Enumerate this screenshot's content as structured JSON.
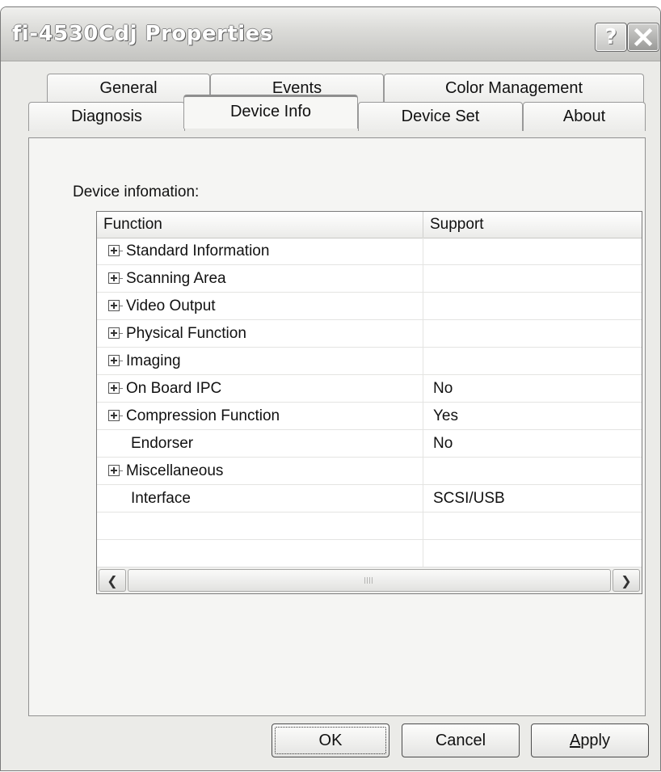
{
  "window": {
    "title": "fi-4530Cdj Properties",
    "help_glyph": "?",
    "close_icon": "close-icon"
  },
  "tabs": {
    "row_top": [
      {
        "label": "General"
      },
      {
        "label": "Events"
      },
      {
        "label": "Color Management"
      }
    ],
    "row_bottom": [
      {
        "label": "Diagnosis"
      },
      {
        "label": "Device Info",
        "selected": true
      },
      {
        "label": "Device Set"
      },
      {
        "label": "About"
      }
    ]
  },
  "panel": {
    "label": "Device infomation:"
  },
  "table": {
    "columns": [
      "Function",
      "Support"
    ],
    "rows": [
      {
        "name": "Standard Information",
        "expandable": true,
        "support": ""
      },
      {
        "name": "Scanning Area",
        "expandable": true,
        "support": ""
      },
      {
        "name": "Video Output",
        "expandable": true,
        "support": ""
      },
      {
        "name": "Physical Function",
        "expandable": true,
        "support": ""
      },
      {
        "name": "Imaging",
        "expandable": true,
        "support": ""
      },
      {
        "name": "On Board IPC",
        "expandable": true,
        "support": "No"
      },
      {
        "name": "Compression Function",
        "expandable": true,
        "support": "Yes"
      },
      {
        "name": "Endorser",
        "expandable": false,
        "support": "No"
      },
      {
        "name": "Miscellaneous",
        "expandable": true,
        "support": ""
      },
      {
        "name": "Interface",
        "expandable": false,
        "support": "SCSI/USB"
      },
      {
        "name": "",
        "expandable": false,
        "support": ""
      },
      {
        "name": "",
        "expandable": false,
        "support": ""
      }
    ]
  },
  "buttons": {
    "ok": "OK",
    "cancel": "Cancel",
    "apply_accel": "A",
    "apply_rest": "pply"
  },
  "colors": {
    "window_bg": "#ebebe8",
    "panel_bg": "#f5f5f3"
  }
}
